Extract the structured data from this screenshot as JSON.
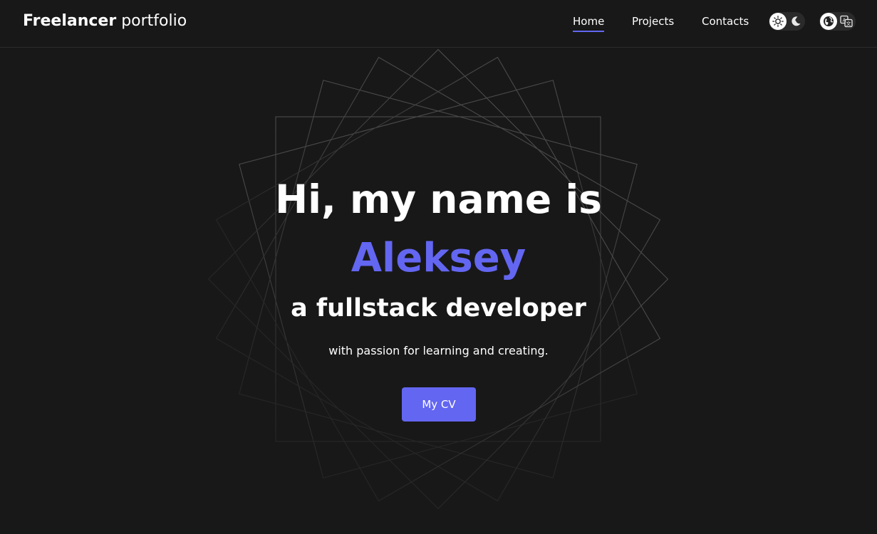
{
  "header": {
    "logo_bold": "Freelancer",
    "logo_light": "portfolio",
    "nav": {
      "home": "Home",
      "projects": "Projects",
      "contacts": "Contacts"
    },
    "theme_toggle": {
      "on_icon": "sun-icon",
      "off_icon": "moon-icon"
    },
    "language_toggle": {
      "on_icon": "globe-icon",
      "off_icon": "translate-icon"
    }
  },
  "hero": {
    "greeting": "Hi, my name is",
    "name": "Aleksey",
    "role": "a fullstack developer",
    "tagline": "with passion for learning and creating.",
    "cv_button": "My CV"
  },
  "colors": {
    "background": "#181818",
    "accent": "#6366f1",
    "text": "#ffffff"
  }
}
